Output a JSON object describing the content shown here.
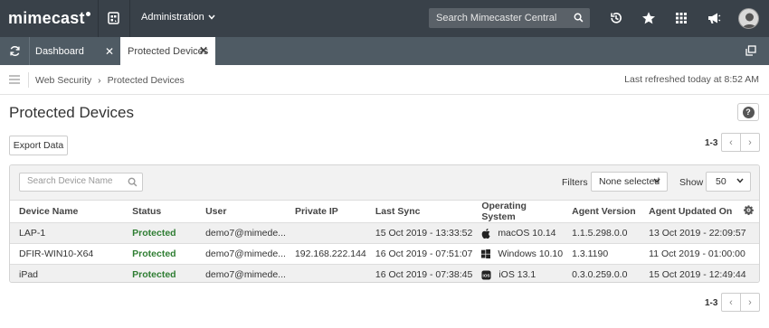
{
  "topbar": {
    "logo": "mimecast",
    "admin_label": "Administration",
    "search_placeholder": "Search Mimecaster Central"
  },
  "tabs": [
    {
      "label": "Dashboard"
    },
    {
      "label": "Protected Devices"
    }
  ],
  "breadcrumb": {
    "parent": "Web Security",
    "separator": "›",
    "current": "Protected Devices",
    "refreshed": "Last refreshed today at 8:52 AM"
  },
  "page": {
    "title": "Protected Devices",
    "export_label": "Export Data",
    "help_label": "?"
  },
  "pager": {
    "range": "1-3",
    "prev": "‹",
    "next": "›"
  },
  "filters": {
    "search_placeholder": "Search Device Name",
    "filters_label": "Filters",
    "filters_value": "None selected",
    "show_label": "Show",
    "show_value": "50"
  },
  "table": {
    "columns": [
      "Device Name",
      "Status",
      "User",
      "Private IP",
      "Last Sync",
      "Operating System",
      "Agent Version",
      "Agent Updated On"
    ],
    "rows": [
      {
        "device": "LAP-1",
        "status": "Protected",
        "user": "demo7@mimede...",
        "ip": "",
        "sync": "15 Oct 2019 - 13:33:52",
        "os": "macOS 10.14",
        "os_icon": "apple-icon",
        "agent": "1.1.5.298.0.0",
        "updated": "13 Oct 2019 - 22:09:57"
      },
      {
        "device": "DFIR-WIN10-X64",
        "status": "Protected",
        "user": "demo7@mimede...",
        "ip": "192.168.222.144",
        "sync": "16 Oct 2019 - 07:51:07",
        "os": "Windows 10.10",
        "os_icon": "windows-icon",
        "agent": "1.3.1190",
        "updated": "11 Oct 2019 - 01:00:00"
      },
      {
        "device": "iPad",
        "status": "Protected",
        "user": "demo7@mimede...",
        "ip": "",
        "sync": "16 Oct 2019 - 07:38:45",
        "os": "iOS 13.1",
        "os_icon": "ios-icon",
        "agent": "0.3.0.259.0.0",
        "updated": "15 Oct 2019 - 12:49:44"
      }
    ]
  },
  "colors": {
    "topbar": "#394149",
    "tabbar": "#4f5b64",
    "status_green": "#2e7d32"
  }
}
